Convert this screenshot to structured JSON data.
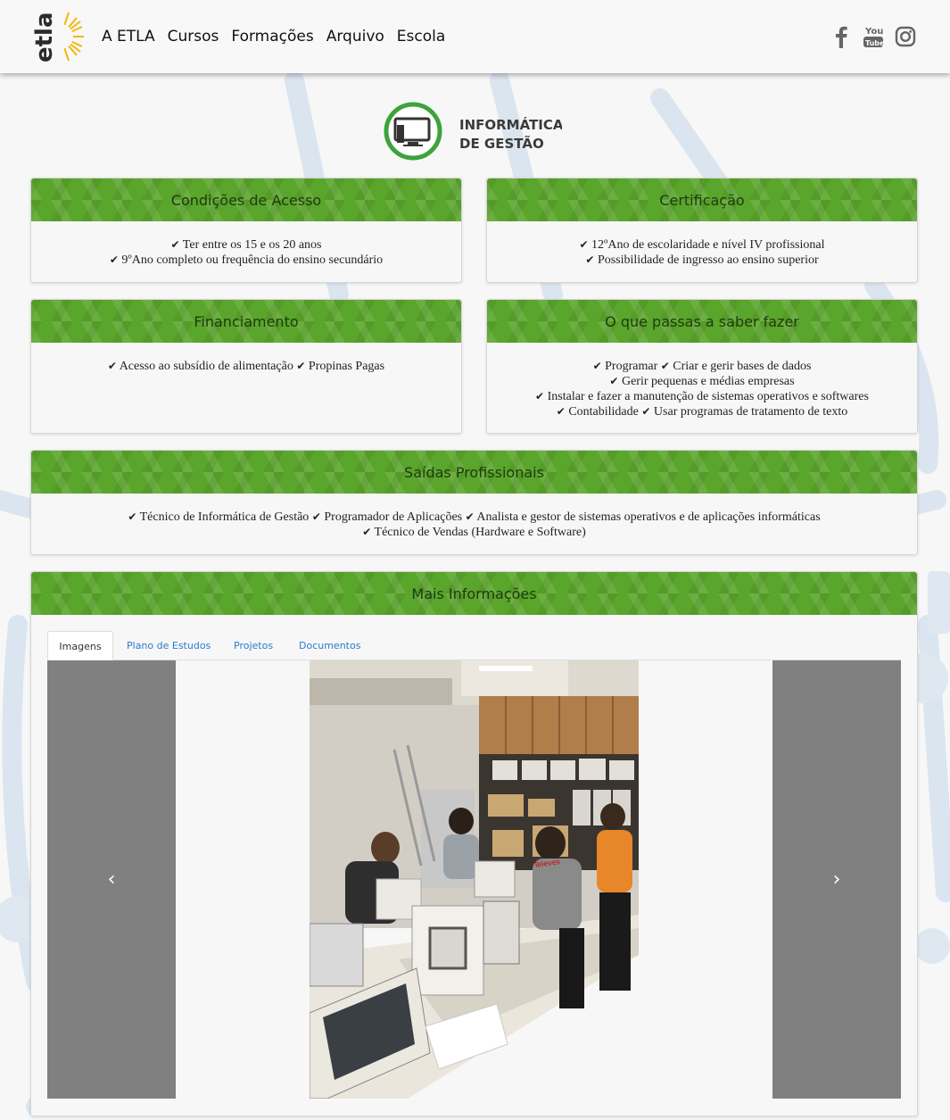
{
  "nav": {
    "logo_text": "etla",
    "links": [
      "A ETLA",
      "Cursos",
      "Formações",
      "Arquivo",
      "Escola"
    ],
    "social": [
      "facebook-icon",
      "youtube-icon",
      "instagram-icon"
    ],
    "youtube_you": "You",
    "youtube_tube": "Tube"
  },
  "course": {
    "title_line1": "INFORMÁTICA",
    "title_line2": "DE GESTÃO"
  },
  "panels": {
    "acesso": {
      "title": "Condições de Acesso",
      "items": [
        "Ter entre os 15 e os 20 anos",
        "9ºAno completo ou frequência do ensino secundário"
      ]
    },
    "certificacao": {
      "title": "Certificação",
      "items": [
        "12ºAno de escolaridade e nível IV profissional",
        "Possibilidade de ingresso ao ensino superior"
      ]
    },
    "financiamento": {
      "title": "Financiamento",
      "items": [
        "Acesso ao subsídio de alimentação",
        "Propinas Pagas"
      ]
    },
    "saber": {
      "title": "O que passas a saber fazer",
      "items": [
        "Programar",
        "Criar e gerir bases de dados",
        "Gerir pequenas e médias empresas",
        "Instalar e fazer a manutenção de sistemas operativos e softwares",
        "Contabilidade",
        "Usar programas de tratamento de texto"
      ]
    },
    "saidas": {
      "title": "Saídas Profissionais",
      "items": [
        "Técnico de Informática de Gestão",
        "Programador de Aplicações",
        "Analista e gestor de sistemas operativos e de aplicações informáticas",
        "Técnico de Vendas (Hardware e Software)"
      ]
    },
    "mais": {
      "title": "Mais Informações",
      "tabs": [
        "Imagens",
        "Plano de Estudos",
        "Projetos",
        "Documentos"
      ]
    }
  },
  "carousel": {
    "prev_glyph": "‹",
    "next_glyph": "›",
    "photo_sign_text": "Televes"
  },
  "colors": {
    "panel_green": "#5aa52b",
    "link_blue": "#2a7ad0",
    "carousel_grey": "#808080"
  }
}
